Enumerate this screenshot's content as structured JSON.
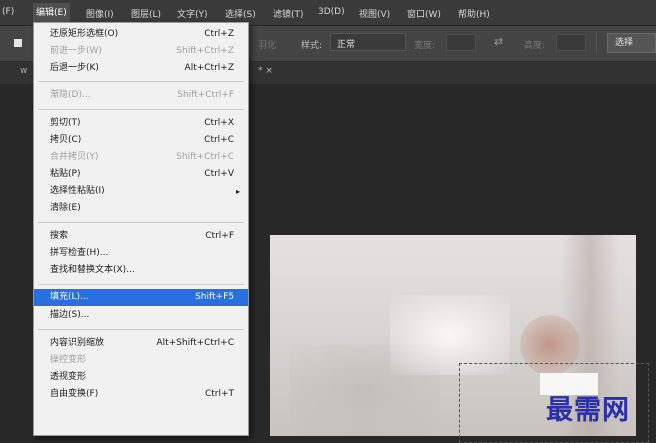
{
  "menubar": {
    "items": [
      "(F)",
      "编辑(E)",
      "图像(I)",
      "图层(L)",
      "文字(Y)",
      "选择(S)",
      "滤镜(T)",
      "3D(D)",
      "视图(V)",
      "窗口(W)",
      "帮助(H)"
    ]
  },
  "options": {
    "feather_label": "羽化",
    "style_label": "样式:",
    "style_value": "正常",
    "width_label": "宽度:",
    "height_label": "高度:",
    "select_button": "选择"
  },
  "tab": {
    "close": "* ×"
  },
  "edit_menu": {
    "items": [
      {
        "label": "还原矩形选框(O)",
        "shortcut": "Ctrl+Z",
        "disabled": false
      },
      {
        "label": "前进一步(W)",
        "shortcut": "Shift+Ctrl+Z",
        "disabled": true
      },
      {
        "label": "后退一步(K)",
        "shortcut": "Alt+Ctrl+Z",
        "disabled": false
      },
      {
        "label": "渐隐(D)...",
        "shortcut": "Shift+Ctrl+F",
        "disabled": true
      },
      {
        "label": "剪切(T)",
        "shortcut": "Ctrl+X",
        "disabled": false
      },
      {
        "label": "拷贝(C)",
        "shortcut": "Ctrl+C",
        "disabled": false
      },
      {
        "label": "合并拷贝(Y)",
        "shortcut": "Shift+Ctrl+C",
        "disabled": true
      },
      {
        "label": "粘贴(P)",
        "shortcut": "Ctrl+V",
        "disabled": false
      },
      {
        "label": "选择性粘贴(I)",
        "shortcut": "",
        "disabled": false,
        "submenu": true
      },
      {
        "label": "清除(E)",
        "shortcut": "",
        "disabled": false
      },
      {
        "label": "搜索",
        "shortcut": "Ctrl+F",
        "disabled": false
      },
      {
        "label": "拼写检查(H)...",
        "shortcut": "",
        "disabled": false
      },
      {
        "label": "查找和替换文本(X)...",
        "shortcut": "",
        "disabled": false
      },
      {
        "label": "填充(L)...",
        "shortcut": "Shift+F5",
        "disabled": false,
        "highlighted": true
      },
      {
        "label": "描边(S)...",
        "shortcut": "",
        "disabled": false
      },
      {
        "label": "内容识别缩放",
        "shortcut": "Alt+Shift+Ctrl+C",
        "disabled": false
      },
      {
        "label": "操控变形",
        "shortcut": "",
        "disabled": true
      },
      {
        "label": "透视变形",
        "shortcut": "",
        "disabled": false
      },
      {
        "label": "自由变换(F)",
        "shortcut": "Ctrl+T",
        "disabled": false
      }
    ]
  },
  "watermark": "最需网",
  "colors": {
    "highlight": "#2a6fe0",
    "menu_bg": "#f1f1f1",
    "watermark": "#2b2fa8"
  }
}
